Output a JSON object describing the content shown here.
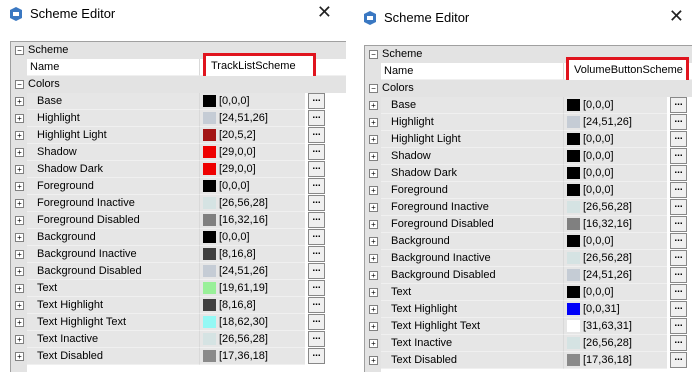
{
  "left": {
    "title": "Scheme Editor",
    "scheme_category": "Scheme",
    "name_label": "Name",
    "name_value": "TrackListScheme",
    "colors_category": "Colors",
    "rows": [
      {
        "label": "Base",
        "value": "[0,0,0]",
        "color": "#000000"
      },
      {
        "label": "Highlight",
        "value": "[24,51,26]",
        "color": "#c5ccd5"
      },
      {
        "label": "Highlight Light",
        "value": "[20,5,2]",
        "color": "#a31515"
      },
      {
        "label": "Shadow",
        "value": "[29,0,0]",
        "color": "#ee0000"
      },
      {
        "label": "Shadow  Dark",
        "value": "[29,0,0]",
        "color": "#ee0000"
      },
      {
        "label": "Foreground",
        "value": "[0,0,0]",
        "color": "#000000"
      },
      {
        "label": "Foreground Inactive",
        "value": "[26,56,28]",
        "color": "#d5e3e3"
      },
      {
        "label": "Foreground Disabled",
        "value": "[16,32,16]",
        "color": "#808080"
      },
      {
        "label": "Background",
        "value": "[0,0,0]",
        "color": "#000000"
      },
      {
        "label": "Background Inactive",
        "value": "[8,16,8]",
        "color": "#404040"
      },
      {
        "label": "Background Disabled",
        "value": "[24,51,26]",
        "color": "#c5ccd5"
      },
      {
        "label": "Text",
        "value": "[19,61,19]",
        "color": "#99f099"
      },
      {
        "label": "Text Highlight",
        "value": "[8,16,8]",
        "color": "#404040"
      },
      {
        "label": "Text Highlight Text",
        "value": "[18,62,30]",
        "color": "#94f8f4"
      },
      {
        "label": "Text Inactive",
        "value": "[26,56,28]",
        "color": "#d5e3e3"
      },
      {
        "label": "Text Disabled",
        "value": "[17,36,18]",
        "color": "#8a8a8a"
      }
    ]
  },
  "right": {
    "title": "Scheme Editor",
    "scheme_category": "Scheme",
    "name_label": "Name",
    "name_value": "VolumeButtonScheme",
    "colors_category": "Colors",
    "rows": [
      {
        "label": "Base",
        "value": "[0,0,0]",
        "color": "#000000"
      },
      {
        "label": "Highlight",
        "value": "[24,51,26]",
        "color": "#c5ccd5"
      },
      {
        "label": "Highlight Light",
        "value": "[0,0,0]",
        "color": "#000000"
      },
      {
        "label": "Shadow",
        "value": "[0,0,0]",
        "color": "#000000"
      },
      {
        "label": "Shadow  Dark",
        "value": "[0,0,0]",
        "color": "#000000"
      },
      {
        "label": "Foreground",
        "value": "[0,0,0]",
        "color": "#000000"
      },
      {
        "label": "Foreground Inactive",
        "value": "[26,56,28]",
        "color": "#d5e3e3"
      },
      {
        "label": "Foreground Disabled",
        "value": "[16,32,16]",
        "color": "#808080"
      },
      {
        "label": "Background",
        "value": "[0,0,0]",
        "color": "#000000"
      },
      {
        "label": "Background Inactive",
        "value": "[26,56,28]",
        "color": "#d5e3e3"
      },
      {
        "label": "Background Disabled",
        "value": "[24,51,26]",
        "color": "#c5ccd5"
      },
      {
        "label": "Text",
        "value": "[0,0,0]",
        "color": "#000000"
      },
      {
        "label": "Text Highlight",
        "value": "[0,0,31]",
        "color": "#0000f8"
      },
      {
        "label": "Text Highlight Text",
        "value": "[31,63,31]",
        "color": "#ffffff"
      },
      {
        "label": "Text Inactive",
        "value": "[26,56,28]",
        "color": "#d5e3e3"
      },
      {
        "label": "Text Disabled",
        "value": "[17,36,18]",
        "color": "#8a8a8a"
      }
    ]
  },
  "ellipsis_label": "..."
}
